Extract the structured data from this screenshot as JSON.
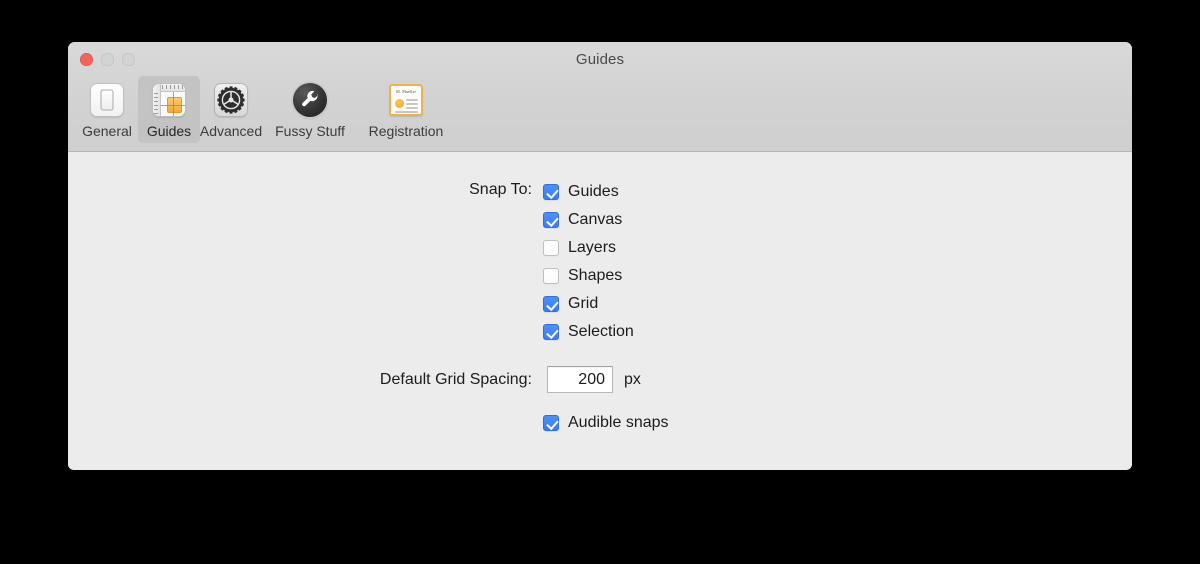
{
  "window": {
    "title": "Guides",
    "traffic_lights": [
      {
        "name": "close",
        "color": "#f0645c"
      },
      {
        "name": "minimize",
        "color": "#d3d3d3"
      },
      {
        "name": "zoom",
        "color": "#d3d3d3"
      }
    ]
  },
  "toolbar": {
    "tabs": [
      {
        "label": "General",
        "icon": "toggle-switch-icon",
        "selected": false
      },
      {
        "label": "Guides",
        "icon": "ruler-grid-icon",
        "selected": true
      },
      {
        "label": "Advanced",
        "icon": "gear-icon",
        "selected": false
      },
      {
        "label": "Fussy Stuff",
        "icon": "wrench-icon",
        "selected": false
      },
      {
        "label": "Registration",
        "icon": "certificate-icon",
        "selected": false
      }
    ]
  },
  "content": {
    "snap_to": {
      "label": "Snap To:",
      "options": [
        {
          "label": "Guides",
          "checked": true
        },
        {
          "label": "Canvas",
          "checked": true
        },
        {
          "label": "Layers",
          "checked": false
        },
        {
          "label": "Shapes",
          "checked": false
        },
        {
          "label": "Grid",
          "checked": true
        },
        {
          "label": "Selection",
          "checked": true
        }
      ]
    },
    "grid_spacing": {
      "label": "Default Grid Spacing:",
      "value": "200",
      "unit": "px"
    },
    "audible_snaps": {
      "label": "Audible snaps",
      "checked": true
    }
  },
  "registration_icon": {
    "name_text": "M. Mueller"
  },
  "colors": {
    "accent": "#3a7df3",
    "window_bg": "#ececec",
    "toolbar_bg": "#d2d2d2",
    "selected_tab_bg": "#c3c3c3",
    "desktop_bg": "#000000"
  }
}
